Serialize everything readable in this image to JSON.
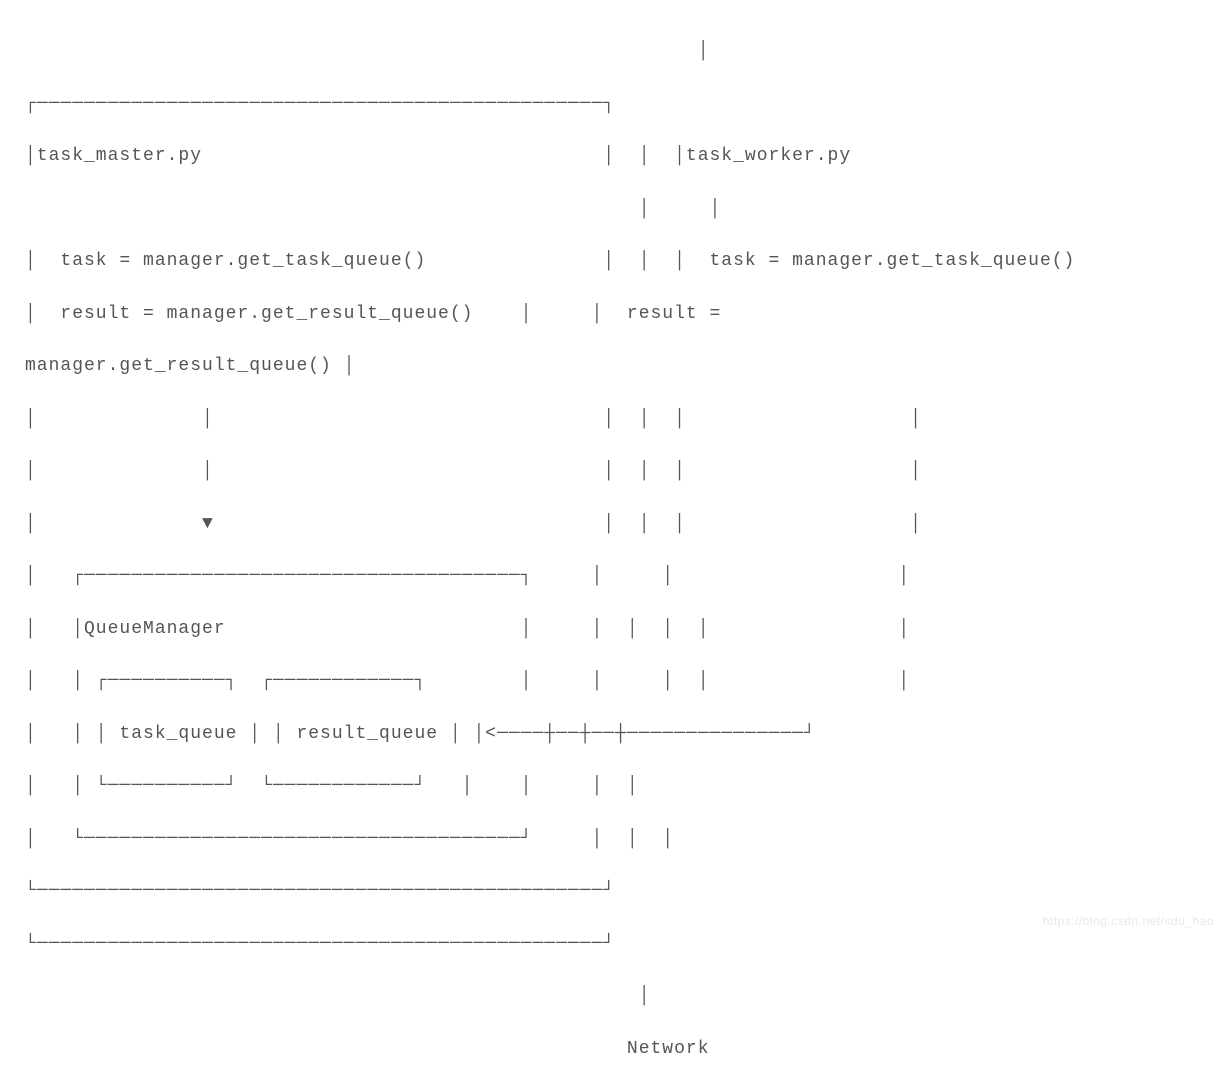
{
  "diagram": {
    "left_box_title": "task_master.py",
    "right_box_title": "task_worker.py",
    "left_code_line1": "task = manager.get_task_queue()",
    "left_code_line2": "result = manager.get_result_queue()",
    "right_code_line1": "task = manager.get_task_queue()",
    "right_code_line2_a": "result =",
    "right_code_line2_b": "manager.get_result_queue() │",
    "inner_box_title": "QueueManager",
    "inner_queue1": "task_queue",
    "inner_queue2": "result_queue",
    "arrow_down": "▼",
    "network_label": "Network",
    "ascii": "                                                         │\n┌────────────────────────────────────────────────┐\n│task_master.py                                  │  │  │task_worker.py\n                                                    │     │\n│  task = manager.get_task_queue()               │  │  │  task = manager.get_task_queue()\n│  result = manager.get_result_queue()    │     │  result =\nmanager.get_result_queue() │\n│              │                                 │  │  │                   │\n│              │                                 │  │  │                   │\n│              ▼                                 │  │  │                   │\n│   ┌─────────────────────────────────────┐     │     │                   │\n│   │QueueManager                         │     │  │  │  │                │\n│   │ ┌──────────┐  ┌────────────┐        │     │     │  │                │\n│   │ │ task_queue │ │ result_queue │ │<────┼──┼──┼───────────────┘\n│   │ └──────────┘  └────────────┘   │    │     │  │\n│   └─────────────────────────────────────┘     │  │  │\n└────────────────────────────────────────────────┘\n└────────────────────────────────────────────────┘\n                                                    │\n                                                   Network"
  },
  "watermark": "https://blog.csdn.net/sdu_hao"
}
